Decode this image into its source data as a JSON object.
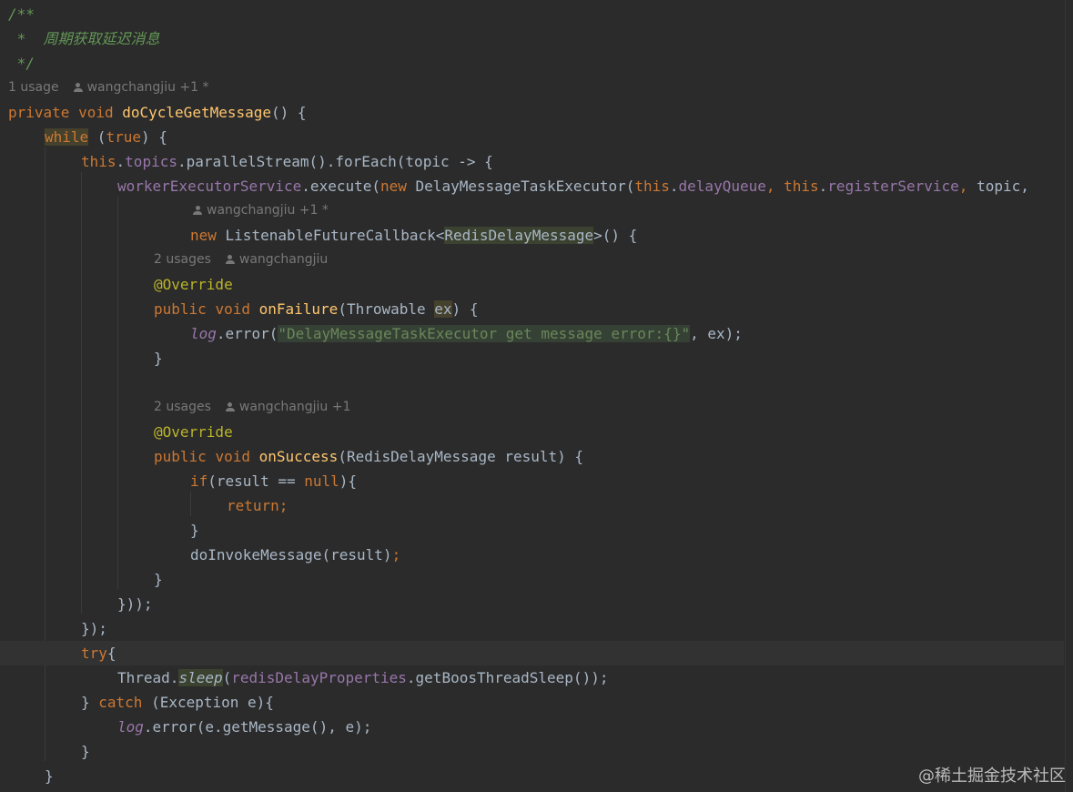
{
  "code": {
    "doc_open": "/**",
    "doc_body": " *  周期获取延迟消息",
    "doc_close": " */",
    "hint_method": {
      "usage": "1 usage",
      "author": "wangchangjiu +1 *"
    },
    "kw_private": "private",
    "kw_void": "void",
    "method_name": "doCycleGetMessage",
    "method_tail": "() {",
    "kw_while": "while",
    "while_tail": " (",
    "kw_true": "true",
    "while_close": ") {",
    "kw_this": "this",
    "fld_topics": "topics",
    "foreach_call": ".parallelStream().forEach(topic -> {",
    "fld_executor": "workerExecutorService",
    "execute_call": ".execute(",
    "kw_new": "new",
    "task_class": " DelayMessageTaskExecutor(",
    "fld_delayqueue": "delayQueue",
    "comma": ", ",
    "fld_register": "registerService",
    "topic_tail": "topic,",
    "hint_callback": {
      "author": "wangchangjiu +1 *"
    },
    "callback_class": " ListenableFutureCallback<",
    "generic_type": "RedisDelayMessage",
    "callback_tail": ">() {",
    "hint_failure": {
      "usage": "2 usages",
      "author": "wangchangjiu"
    },
    "ann_override": "@Override",
    "kw_public": "public",
    "fn_onfailure": "onFailure",
    "failure_params_open": "(Throwable ",
    "param_ex": "ex",
    "failure_params_close": ") {",
    "log_field": "log",
    "error_call": ".error(",
    "error_string": "\"DelayMessageTaskExecutor get message error:{}\"",
    "error_tail": ", ex);",
    "close_brace": "}",
    "hint_success": {
      "usage": "2 usages",
      "author": "wangchangjiu +1"
    },
    "fn_onsuccess": "onSuccess",
    "success_params": "(RedisDelayMessage result) {",
    "kw_if": "if",
    "if_cond": "(result == ",
    "kw_null": "null",
    "if_tail": "){",
    "kw_return": "return",
    "semicolon": ";",
    "invoke_call": "doInvokeMessage(result)",
    "close_callback": "}));",
    "close_foreach": "});",
    "kw_try": "try",
    "try_brace": "{",
    "thread_class": "Thread.",
    "sleep_call": "sleep",
    "sleep_open": "(",
    "fld_props": "redisDelayProperties",
    "sleep_tail": ".getBoosThreadSleep());",
    "catch_open": "} ",
    "kw_catch": "catch",
    "catch_tail": " (Exception e){",
    "log_error_msg": ".error(e.getMessage(), e);"
  },
  "watermark": "@稀土掘金技术社区"
}
